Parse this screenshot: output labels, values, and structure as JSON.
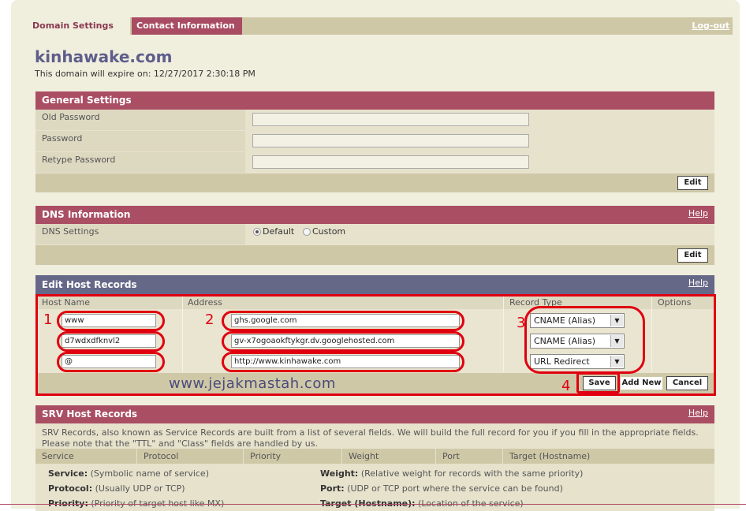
{
  "tabs": {
    "domain_settings": "Domain Settings",
    "contact_information": "Contact Information",
    "logout": "Log-out"
  },
  "domain": {
    "name": "kinhawake.com",
    "expire": "This domain will expire on: 12/27/2017 2:30:18 PM"
  },
  "general": {
    "title": "General Settings",
    "fields": [
      {
        "label": "Old Password"
      },
      {
        "label": "Password"
      },
      {
        "label": "Retype Password"
      }
    ],
    "edit": "Edit"
  },
  "dns": {
    "title": "DNS Information",
    "help": "Help",
    "settings_label": "DNS Settings",
    "default": "Default",
    "custom": "Custom",
    "edit": "Edit"
  },
  "host": {
    "title": "Edit Host Records",
    "help": "Help",
    "columns": {
      "host": "Host Name",
      "address": "Address",
      "type": "Record Type",
      "options": "Options"
    },
    "rows": [
      {
        "host": "www",
        "address": "ghs.google.com",
        "type": "CNAME (Alias)"
      },
      {
        "host": "d7wdxdfknvl2",
        "address": "gv-x7ogoaokftykgr.dv.googlehosted.com",
        "type": "CNAME (Alias)"
      },
      {
        "host": "@",
        "address": "http://www.kinhawake.com",
        "type": "URL Redirect"
      }
    ],
    "save": "Save",
    "add_new": "Add New",
    "cancel": "Cancel",
    "annotations": [
      "1",
      "2",
      "3",
      "4"
    ],
    "watermark": "www.jejakmastah.com"
  },
  "srv": {
    "title": "SRV Host Records",
    "help": "Help",
    "description": "SRV Records, also known as Service Records are built from a list of several fields. We will build the full record for you if you fill in the appropriate fields. Please note that the \"TTL\" and \"Class\" fields are handled by us.",
    "columns": [
      "Service",
      "Protocol",
      "Priority",
      "Weight",
      "Port",
      "Target (Hostname)"
    ],
    "defs": [
      {
        "term": "Service:",
        "desc": "(Symbolic name of service)"
      },
      {
        "term": "Weight:",
        "desc": "(Relative weight for records with the same priority)"
      },
      {
        "term": "Protocol:",
        "desc": "(Usually UDP or TCP)"
      },
      {
        "term": "Port:",
        "desc": "(UDP or TCP port where the service can be found)"
      },
      {
        "term": "Priority:",
        "desc": "(Priority of target host like MX)"
      },
      {
        "term": "Target (Hostname):",
        "desc": "(Location of the service)"
      }
    ]
  },
  "colors": {
    "accent": "#aa4e64",
    "header_blue": "#666888",
    "highlight": "#e00010"
  }
}
